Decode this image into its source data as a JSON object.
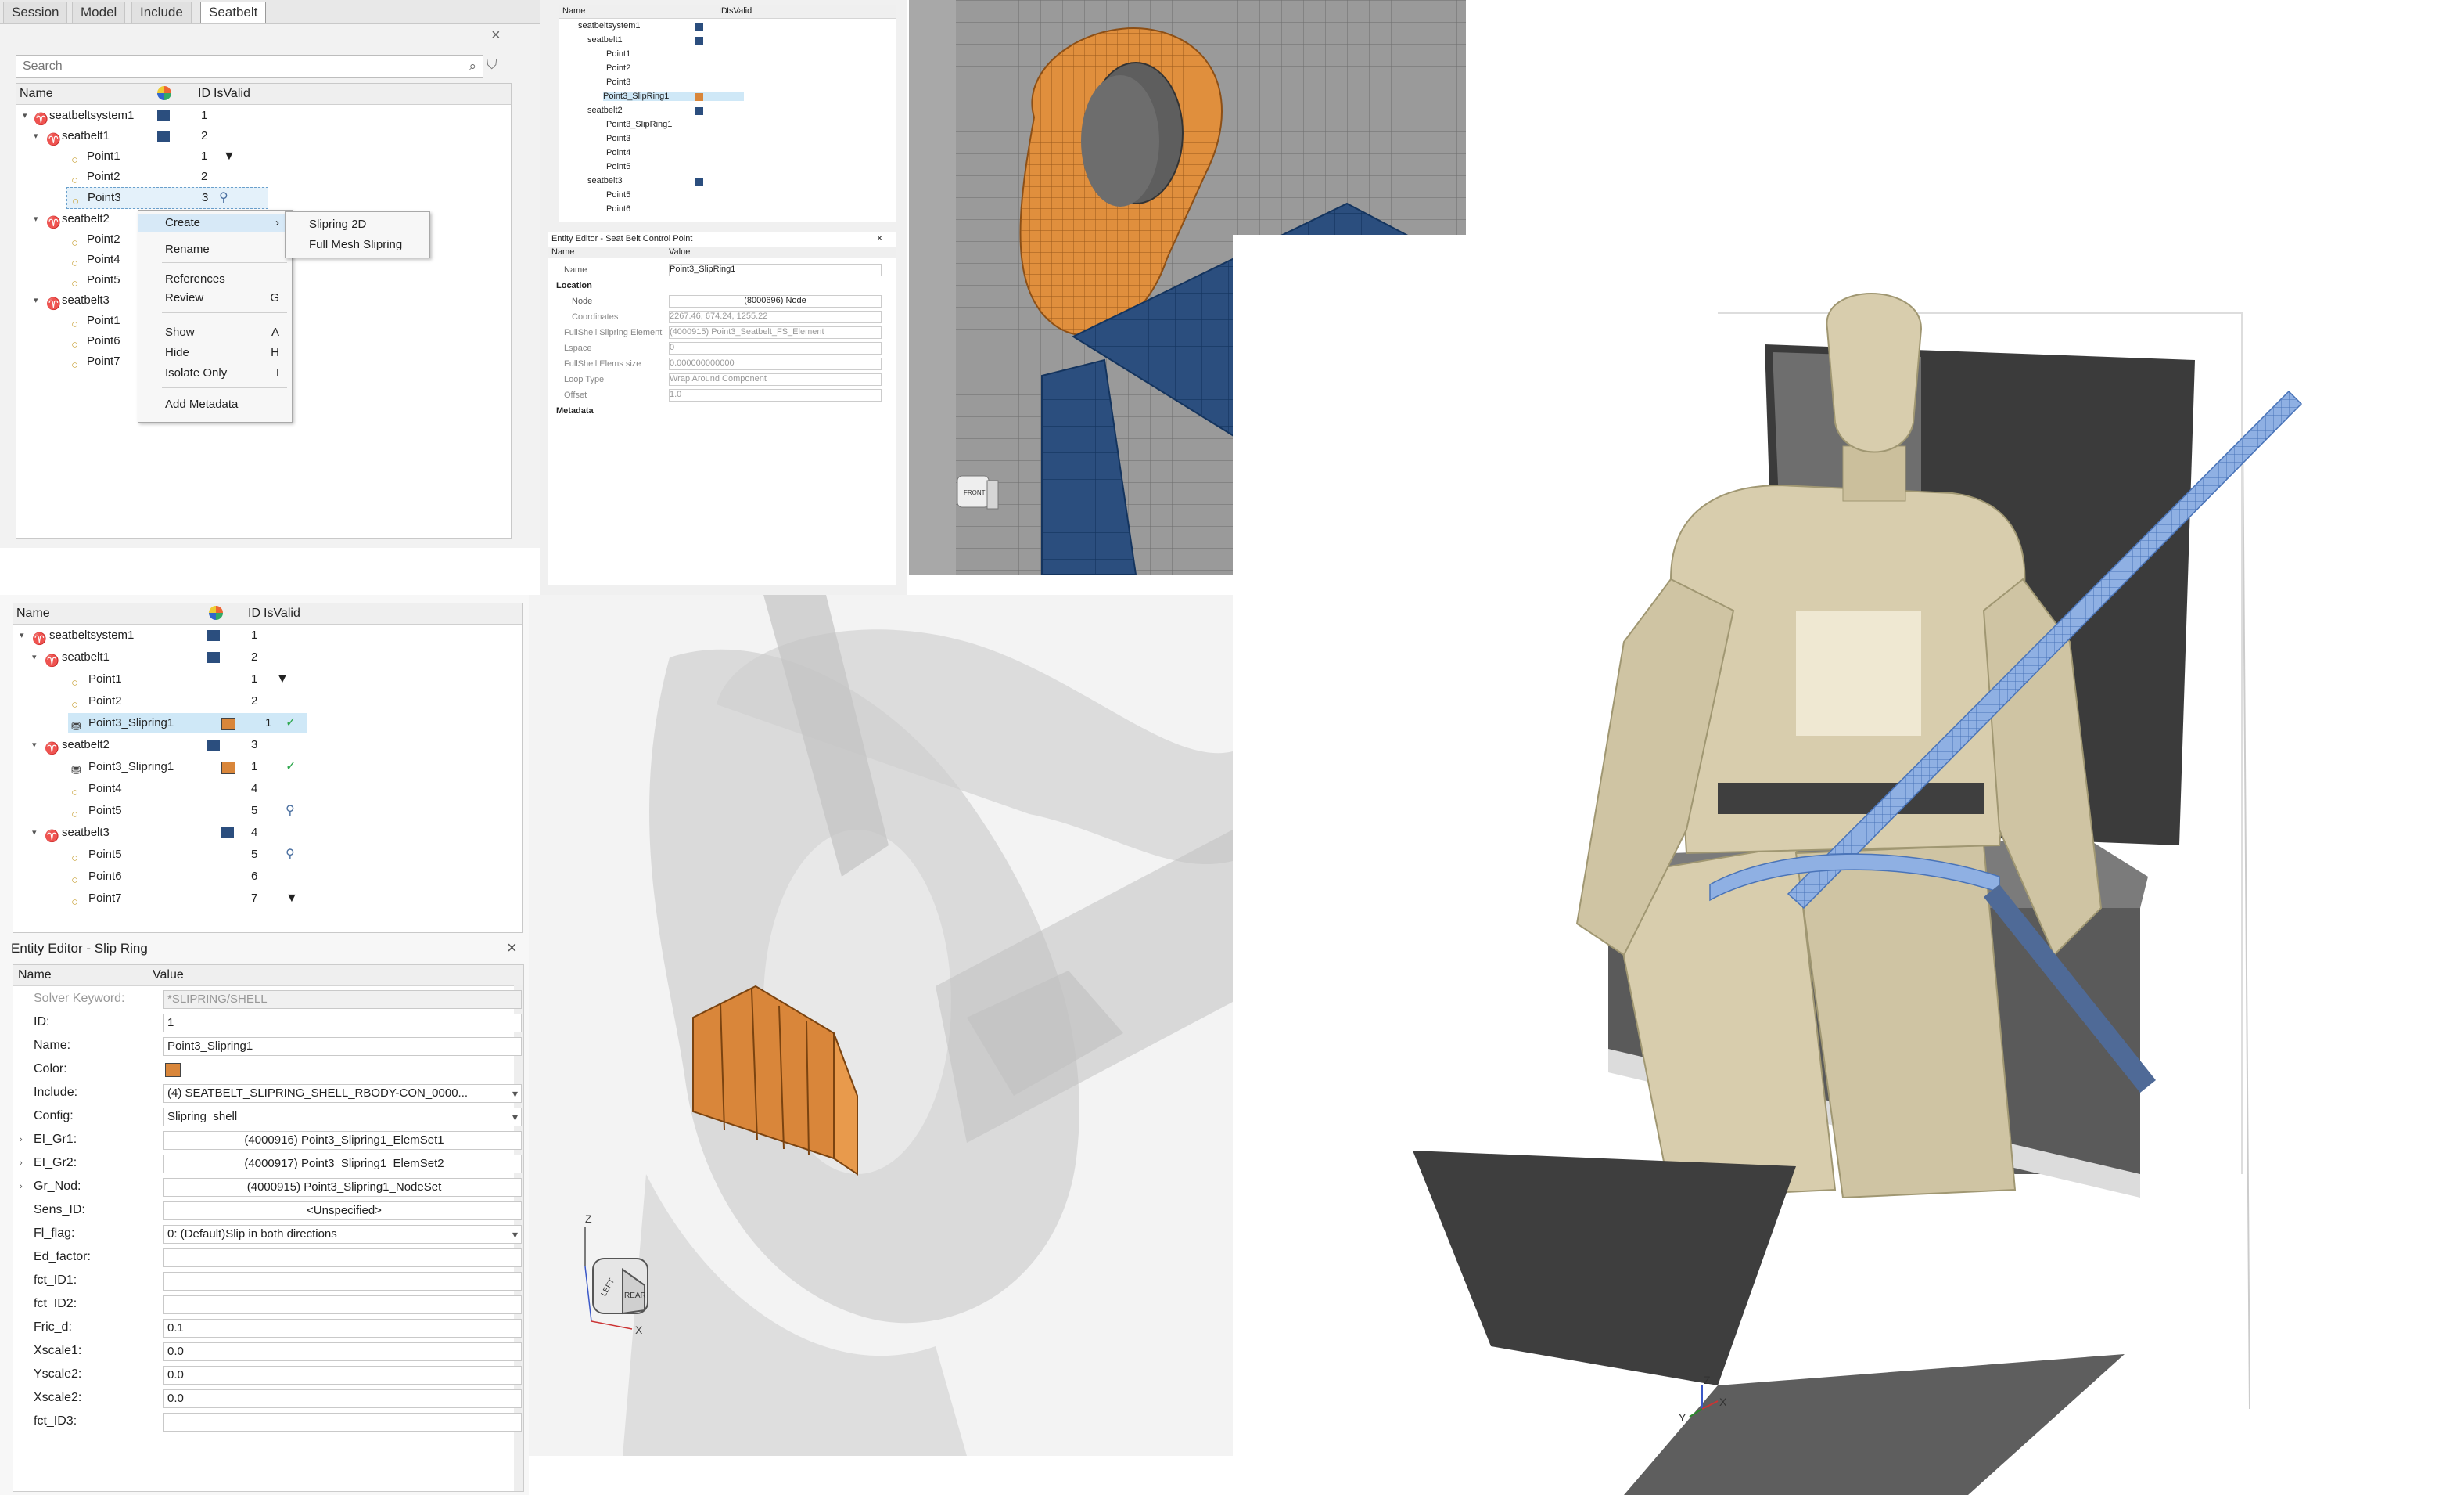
{
  "top_browser": {
    "tabs": [
      "Session",
      "Model",
      "Include",
      "Seatbelt"
    ],
    "active_tab": 3,
    "search_placeholder": "Search",
    "columns": {
      "name": "Name",
      "id": "ID",
      "isvalid": "IsValid"
    },
    "rows": [
      {
        "label": "seatbeltsystem1",
        "id": "1"
      },
      {
        "label": "seatbelt1",
        "id": "2"
      },
      {
        "label": "Point1",
        "id": "1"
      },
      {
        "label": "Point2",
        "id": "2"
      },
      {
        "label": "Point3",
        "id": "3"
      },
      {
        "label": "seatbelt2",
        "id": ""
      },
      {
        "label": "Point2",
        "id": ""
      },
      {
        "label": "Point4",
        "id": ""
      },
      {
        "label": "Point5",
        "id": ""
      },
      {
        "label": "seatbelt3",
        "id": ""
      },
      {
        "label": "Point1",
        "id": ""
      },
      {
        "label": "Point6",
        "id": ""
      },
      {
        "label": "Point7",
        "id": ""
      }
    ],
    "context_menu": {
      "items": [
        {
          "label": "Create",
          "key": ""
        },
        {
          "label": "Rename",
          "key": ""
        },
        {
          "label": "References",
          "key": ""
        },
        {
          "label": "Review",
          "key": "G"
        },
        {
          "label": "Show",
          "key": "A"
        },
        {
          "label": "Hide",
          "key": "H"
        },
        {
          "label": "Isolate Only",
          "key": "I"
        },
        {
          "label": "Add Metadata",
          "key": ""
        }
      ],
      "submenu": [
        "Slipring 2D",
        "Full Mesh Slipring"
      ]
    }
  },
  "mini_panel": {
    "rows": [
      "seatbeltsystem1",
      "seatbelt1",
      "Point1",
      "Point2",
      "Point3",
      "Point3_SlipRing1",
      "seatbelt2",
      "Point3_SlipRing1",
      "Point3",
      "Point4",
      "Point5",
      "seatbelt3",
      "Point5",
      "Point6"
    ],
    "editor_title": "Entity Editor - Seat Belt Control Point",
    "editor_rows": [
      {
        "name": "Name",
        "value": "Point3_SlipRing1"
      },
      {
        "name": "Location",
        "value": ""
      },
      {
        "name": "Node",
        "value": "(8000696) Node"
      },
      {
        "name": "Coordinates",
        "value": "2267.46, 674.24, 1255.22"
      },
      {
        "name": "FullShell Slipring Element",
        "value": "(4000915) Point3_Seatbelt_FS_Element"
      },
      {
        "name": "Lspace",
        "value": "0"
      },
      {
        "name": "FullShell Elems size",
        "value": "0.000000000000"
      },
      {
        "name": "Loop Type",
        "value": "Wrap Around Component"
      },
      {
        "name": "Offset",
        "value": "1.0"
      },
      {
        "name": "Metadata",
        "value": ""
      }
    ]
  },
  "bottom_browser": {
    "columns": {
      "name": "Name",
      "id": "ID",
      "isvalid": "IsValid"
    },
    "rows": [
      {
        "label": "seatbeltsystem1",
        "id": "1"
      },
      {
        "label": "seatbelt1",
        "id": "2"
      },
      {
        "label": "Point1",
        "id": "1"
      },
      {
        "label": "Point2",
        "id": "2"
      },
      {
        "label": "Point3_Slipring1",
        "id": "1"
      },
      {
        "label": "seatbelt2",
        "id": "3"
      },
      {
        "label": "Point3_Slipring1",
        "id": "1"
      },
      {
        "label": "Point4",
        "id": "4"
      },
      {
        "label": "Point5",
        "id": "5"
      },
      {
        "label": "seatbelt3",
        "id": "4"
      },
      {
        "label": "Point5",
        "id": "5"
      },
      {
        "label": "Point6",
        "id": "6"
      },
      {
        "label": "Point7",
        "id": "7"
      }
    ],
    "editor": {
      "title": "Entity Editor - Slip Ring",
      "col_name": "Name",
      "col_value": "Value",
      "rows": [
        {
          "name": "Solver Keyword:",
          "value": "*SLIPRING/SHELL"
        },
        {
          "name": "ID:",
          "value": "1"
        },
        {
          "name": "Name:",
          "value": "Point3_Slipring1"
        },
        {
          "name": "Color:",
          "value": ""
        },
        {
          "name": "Include:",
          "value": "(4) SEATBELT_SLIPRING_SHELL_RBODY-CON_0000..."
        },
        {
          "name": "Config:",
          "value": "Slipring_shell"
        },
        {
          "name": "EI_Gr1:",
          "value": "(4000916) Point3_Slipring1_ElemSet1"
        },
        {
          "name": "EI_Gr2:",
          "value": "(4000917) Point3_Slipring1_ElemSet2"
        },
        {
          "name": "Gr_Nod:",
          "value": "(4000915) Point3_Slipring1_NodeSet"
        },
        {
          "name": "Sens_ID:",
          "value": "<Unspecified>"
        },
        {
          "name": "Fl_flag:",
          "value": "0: (Default)Slip in both directions"
        },
        {
          "name": "Ed_factor:",
          "value": ""
        },
        {
          "name": "fct_ID1:",
          "value": ""
        },
        {
          "name": "fct_ID2:",
          "value": ""
        },
        {
          "name": "Fric_d:",
          "value": "0.1"
        },
        {
          "name": "Xscale1:",
          "value": "0.0"
        },
        {
          "name": "Yscale2:",
          "value": "0.0"
        },
        {
          "name": "Xscale2:",
          "value": "0.0"
        },
        {
          "name": "fct_ID3:",
          "value": ""
        }
      ]
    }
  },
  "triads": {
    "z": "Z",
    "x": "X",
    "y": "Y"
  },
  "viewcube": {
    "front": "FRONT",
    "rear": "REAR",
    "left": "LEFT"
  },
  "colors": {
    "dark_blue": "#2b4e7e",
    "orange": "#d9863a",
    "green": "#2fa84f",
    "selection": "#cfe8f7"
  }
}
